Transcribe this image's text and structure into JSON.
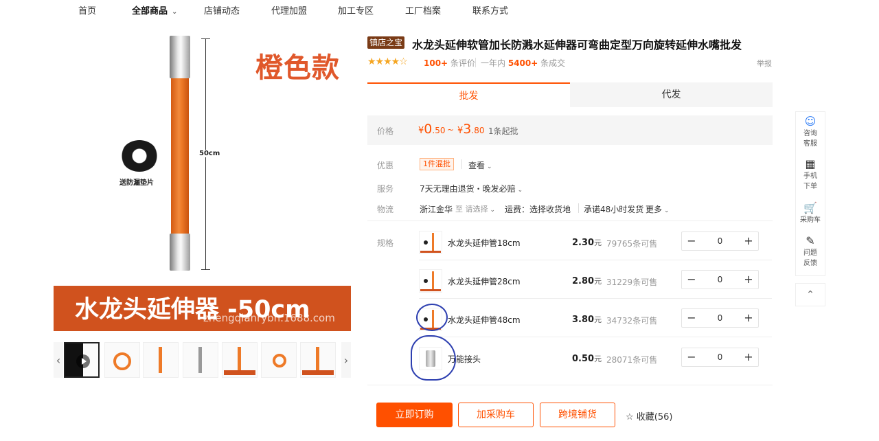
{
  "nav": {
    "items": [
      "首页",
      "全部商品",
      "店铺动态",
      "代理加盟",
      "加工专区",
      "工厂档案",
      "联系方式"
    ]
  },
  "gallery": {
    "color_tag": "橙色款",
    "length_label": "50cm",
    "washer_label": "送防漏垫片",
    "banner_text": "水龙头延伸器 -50cm",
    "watermark": "zhengqianrybn.1688.com"
  },
  "product": {
    "badge": "镇店之宝",
    "title": "水龙头延伸软管加长防溅水延伸器可弯曲定型万向旋转延伸水嘴批发",
    "reviews_count": "100+",
    "reviews_label": "条评价",
    "sales_period": "一年内",
    "sales_count": "5400+",
    "sales_label": "条成交",
    "report": "举报"
  },
  "tabs": {
    "wholesale": "批发",
    "dropship": "代发"
  },
  "price": {
    "label": "价格",
    "yen": "¥",
    "min_int": "0",
    "min_dec": ".50",
    "sep": "~",
    "max_int": "3",
    "max_dec": ".80",
    "min_order": "1条起批"
  },
  "promo": {
    "label": "优惠",
    "tag": "1件混批",
    "view": "查看"
  },
  "service": {
    "label": "服务",
    "text": "7天无理由退货・晚发必赔"
  },
  "logistics": {
    "label": "物流",
    "origin": "浙江金华",
    "to": "至 请选择",
    "shipping": "运费：选择收货地",
    "promise": "承诺48小时发货",
    "more": "更多"
  },
  "spec": {
    "label": "规格",
    "unit": "元",
    "stock_suffix": "条可售",
    "items": [
      {
        "name": "水龙头延伸管18cm",
        "price": "2.30",
        "stock": "79765",
        "qty": "0"
      },
      {
        "name": "水龙头延伸管28cm",
        "price": "2.80",
        "stock": "31229",
        "qty": "0"
      },
      {
        "name": "水龙头延伸管48cm",
        "price": "3.80",
        "stock": "34732",
        "qty": "0"
      },
      {
        "name": "万能接头",
        "price": "0.50",
        "stock": "28071",
        "qty": "0"
      }
    ]
  },
  "actions": {
    "order": "立即订购",
    "add_cart": "加采购车",
    "cross_border": "跨境铺货",
    "favorite": "收藏(56)"
  },
  "sidebar": {
    "service": "咨询客服",
    "mobile": "手机下单",
    "cart": "采购车",
    "feedback": "问题反馈"
  },
  "colors": {
    "accent": "#ff5000",
    "brand_orange": "#d0521e",
    "annotation": "#2d3fb0"
  }
}
